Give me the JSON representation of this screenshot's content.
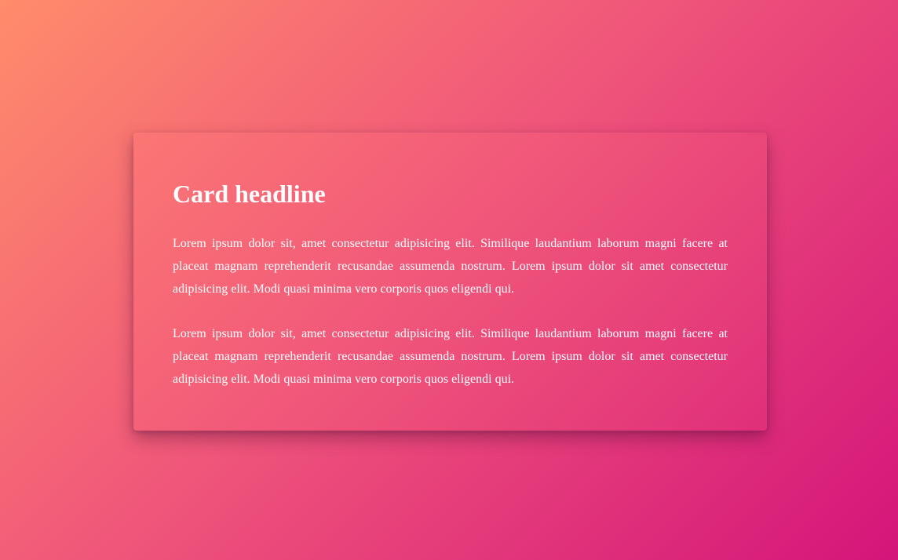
{
  "card": {
    "headline": "Card headline",
    "paragraphs": [
      "Lorem ipsum dolor sit, amet consectetur adipisicing elit. Similique laudantium laborum magni facere at placeat magnam reprehenderit recusandae assumenda nostrum. Lorem ipsum dolor sit amet consectetur adipisicing elit. Modi quasi minima vero corporis quos eligendi qui.",
      "Lorem ipsum dolor sit, amet consectetur adipisicing elit. Similique laudantium laborum magni facere at placeat magnam reprehenderit recusandae assumenda nostrum. Lorem ipsum dolor sit amet consectetur adipisicing elit. Modi quasi minima vero corporis quos eligendi qui."
    ]
  },
  "colors": {
    "gradient_start": "#ff8c6b",
    "gradient_mid": "#f0567a",
    "gradient_end": "#d4157a",
    "text": "#ffffff"
  }
}
